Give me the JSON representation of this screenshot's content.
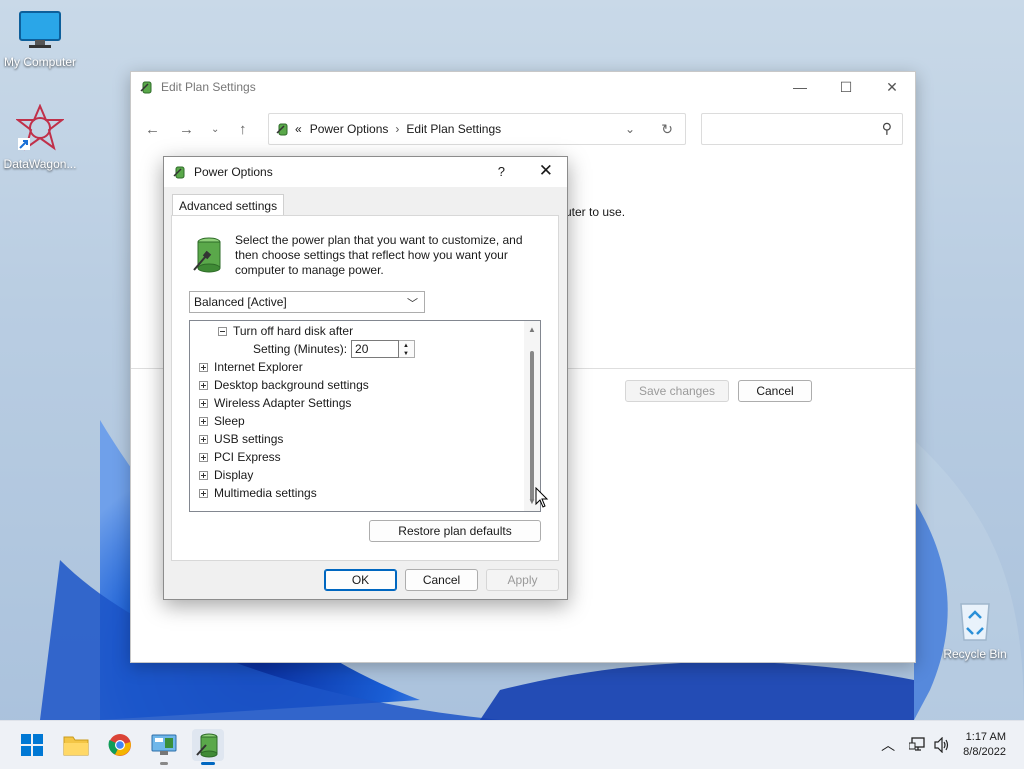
{
  "desktop": {
    "icons": [
      {
        "label": "My Computer"
      },
      {
        "label": "DataWagon..."
      },
      {
        "label": "Recycle Bin"
      }
    ]
  },
  "explorer": {
    "title": "Edit Plan Settings",
    "address": {
      "chevrons": "«",
      "crumb1": "Power Options",
      "separator": "›",
      "crumb2": "Edit Plan Settings"
    },
    "search_placeholder": "",
    "partial_text": "uter to use.",
    "save_label": "Save changes",
    "cancel_label": "Cancel"
  },
  "dialog": {
    "title": "Power Options",
    "help": "?",
    "tab": "Advanced settings",
    "intro": "Select the power plan that you want to customize, and then choose settings that reflect how you want your computer to manage power.",
    "plan_selected": "Balanced [Active]",
    "tree": {
      "expanded_item": "Turn off hard disk after",
      "setting_label": "Setting (Minutes):",
      "setting_value": "20",
      "items": [
        "Internet Explorer",
        "Desktop background settings",
        "Wireless Adapter Settings",
        "Sleep",
        "USB settings",
        "PCI Express",
        "Display",
        "Multimedia settings"
      ]
    },
    "restore_label": "Restore plan defaults",
    "ok_label": "OK",
    "cancel_label": "Cancel",
    "apply_label": "Apply"
  },
  "taskbar": {
    "time": "1:17 AM",
    "date": "8/8/2022"
  },
  "colors": {
    "accent": "#0067c0",
    "wallpaper": "#1a5fd6"
  }
}
